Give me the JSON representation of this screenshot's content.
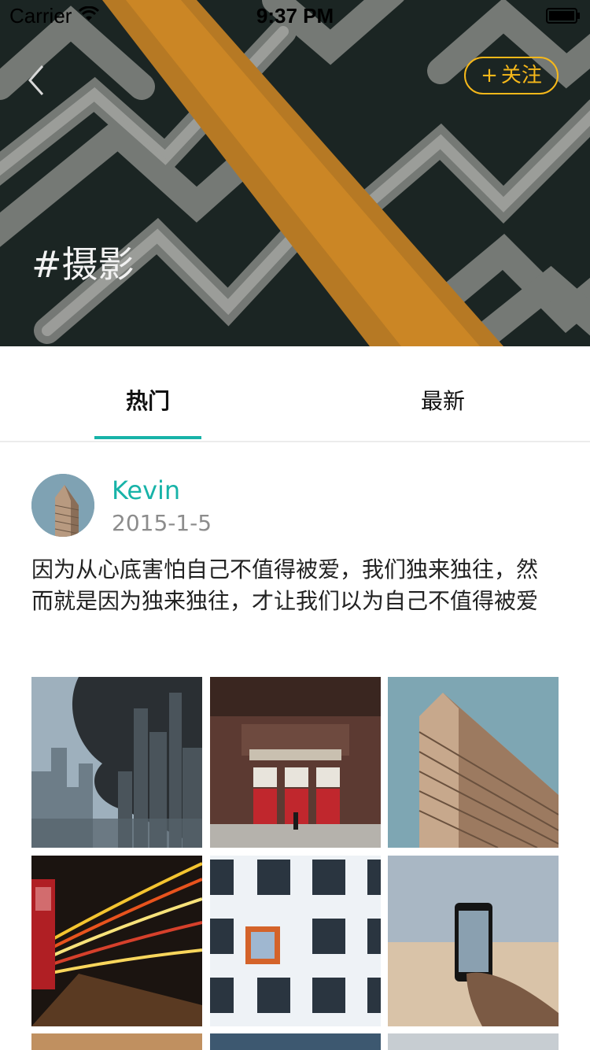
{
  "status_bar": {
    "carrier": "Carrier",
    "time": "9:37 PM"
  },
  "header": {
    "back_icon": "chevron-left-icon",
    "follow_plus": "+",
    "follow_label": "关注",
    "title": "#摄影"
  },
  "tabs": [
    {
      "label": "热门",
      "active": true
    },
    {
      "label": "最新",
      "active": false
    }
  ],
  "post": {
    "author": "Kevin",
    "date": "2015-1-5",
    "text": "因为从心底害怕自己不值得被爱，我们独来独往，然而就是因为独来独往，才让我们以为自己不值得被爱"
  },
  "colors": {
    "accent": "#17b3a8",
    "follow": "#f6b81a",
    "hero_bg": "#1f2b28"
  }
}
